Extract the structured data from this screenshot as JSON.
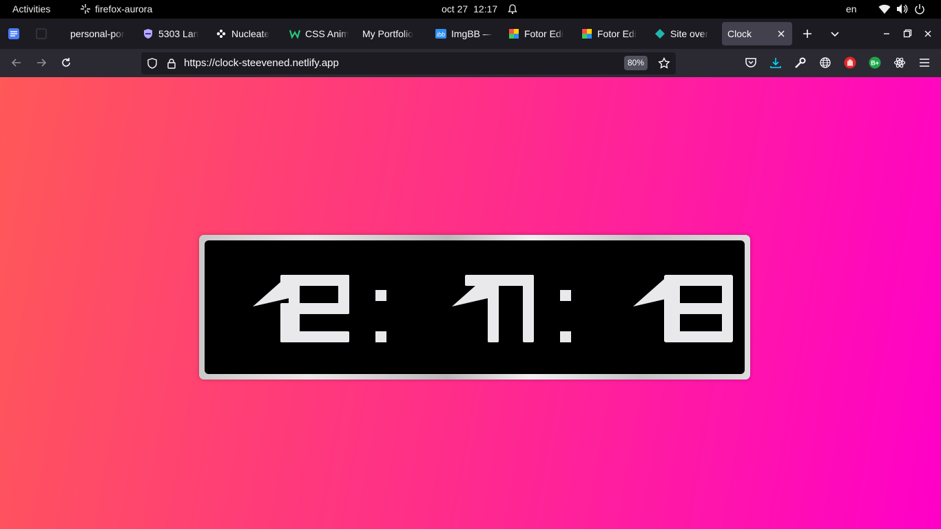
{
  "system_bar": {
    "activities_label": "Activities",
    "app_name": "firefox-aurora",
    "date": "oct 27",
    "time": "12:17",
    "language": "en"
  },
  "tabs": [
    {
      "title": "personal-por",
      "favicon": "none"
    },
    {
      "title": "5303 Lan",
      "favicon": "shield-purple-icon"
    },
    {
      "title": "Nucleate",
      "favicon": "nucleate-icon"
    },
    {
      "title": "CSS Anim",
      "favicon": "w-green-icon"
    },
    {
      "title": "My Portfolio",
      "favicon": "none"
    },
    {
      "title": "ImgBB —",
      "favicon": "ibb-icon"
    },
    {
      "title": "Fotor Edi",
      "favicon": "fotor-icon"
    },
    {
      "title": "Fotor Edi",
      "favicon": "fotor-icon"
    },
    {
      "title": "Site over",
      "favicon": "netlify-diamond-icon"
    },
    {
      "title": "Clock",
      "favicon": "none",
      "active": true
    }
  ],
  "navbar": {
    "url": "https://clock-steevened.netlify.app",
    "zoom": "80%"
  },
  "clock_display": {
    "hours": "12",
    "minutes": "17",
    "seconds": "18",
    "text": "12:17:18"
  },
  "colors": {
    "gradient_start": "#ff5858",
    "gradient_end": "#ff00c8",
    "digit_color": "#e9e9ec",
    "face_color": "#000000"
  }
}
